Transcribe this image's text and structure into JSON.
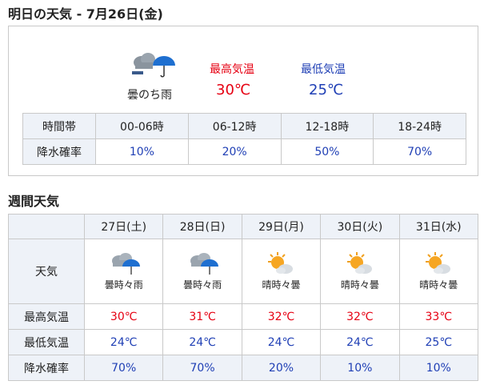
{
  "tomorrow": {
    "heading": "明日の天気 - 7月26日(金)",
    "condition": "曇のち雨",
    "icon": "cloudy-then-rain-icon",
    "high_label": "最高気温",
    "high_value": "30℃",
    "low_label": "最低気温",
    "low_value": "25℃",
    "table": {
      "row1_header": "時間帯",
      "row2_header": "降水確率",
      "slots": [
        "00-06時",
        "06-12時",
        "12-18時",
        "18-24時"
      ],
      "precip": [
        "10%",
        "20%",
        "50%",
        "70%"
      ]
    }
  },
  "weekly": {
    "heading": "週間天気",
    "row_labels": {
      "weather": "天気",
      "high": "最高気温",
      "low": "最低気温",
      "precip": "降水確率"
    },
    "days": [
      {
        "date": "27日(土)",
        "condition": "曇時々雨",
        "icon": "cloud-rain-icon",
        "high": "30℃",
        "low": "24℃",
        "precip": "70%"
      },
      {
        "date": "28日(日)",
        "condition": "曇時々雨",
        "icon": "cloud-rain-icon",
        "high": "31℃",
        "low": "24℃",
        "precip": "70%"
      },
      {
        "date": "29日(月)",
        "condition": "晴時々曇",
        "icon": "sun-cloud-icon",
        "high": "32℃",
        "low": "24℃",
        "precip": "20%"
      },
      {
        "date": "30日(火)",
        "condition": "晴時々曇",
        "icon": "sun-cloud-icon",
        "high": "32℃",
        "low": "24℃",
        "precip": "10%"
      },
      {
        "date": "31日(水)",
        "condition": "晴時々曇",
        "icon": "sun-cloud-icon",
        "high": "33℃",
        "low": "25℃",
        "precip": "10%"
      }
    ]
  },
  "colors": {
    "high": "#e60012",
    "low": "#1f3fb5",
    "header_bg": "#eef2f8",
    "border": "#c9c9c9"
  }
}
